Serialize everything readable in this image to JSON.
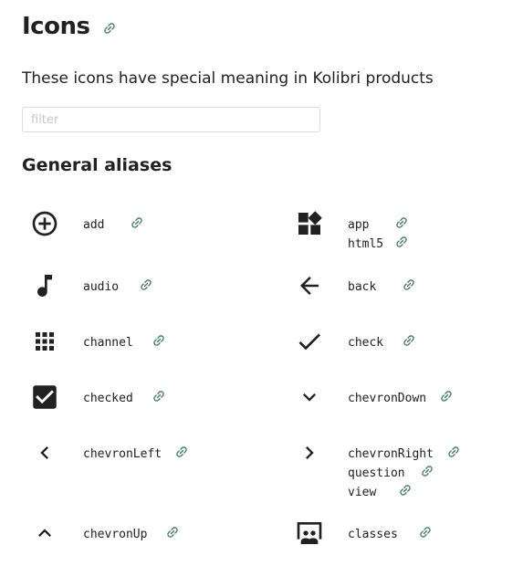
{
  "page": {
    "title": "Icons",
    "subtitle": "These icons have special meaning in Kolibri products",
    "filter_placeholder": "filter",
    "filter_value": "",
    "section_title": "General aliases"
  },
  "colors": {
    "link_icon": "#3a7a5a",
    "icon_fill": "#212121",
    "text": "#212121"
  },
  "icons": [
    {
      "icon": "add-circle-icon",
      "aliases": [
        "add"
      ]
    },
    {
      "icon": "apps-widgets-icon",
      "aliases": [
        "app",
        "html5"
      ]
    },
    {
      "icon": "music-note-icon",
      "aliases": [
        "audio"
      ]
    },
    {
      "icon": "arrow-back-icon",
      "aliases": [
        "back"
      ]
    },
    {
      "icon": "grid-dots-icon",
      "aliases": [
        "channel"
      ]
    },
    {
      "icon": "check-icon",
      "aliases": [
        "check"
      ]
    },
    {
      "icon": "checkbox-checked-icon",
      "aliases": [
        "checked"
      ]
    },
    {
      "icon": "chevron-down-icon",
      "aliases": [
        "chevronDown"
      ]
    },
    {
      "icon": "chevron-left-icon",
      "aliases": [
        "chevronLeft"
      ]
    },
    {
      "icon": "chevron-right-icon",
      "aliases": [
        "chevronRight",
        "question",
        "view"
      ]
    },
    {
      "icon": "chevron-up-icon",
      "aliases": [
        "chevronUp"
      ]
    },
    {
      "icon": "classroom-icon",
      "aliases": [
        "classes"
      ]
    }
  ]
}
